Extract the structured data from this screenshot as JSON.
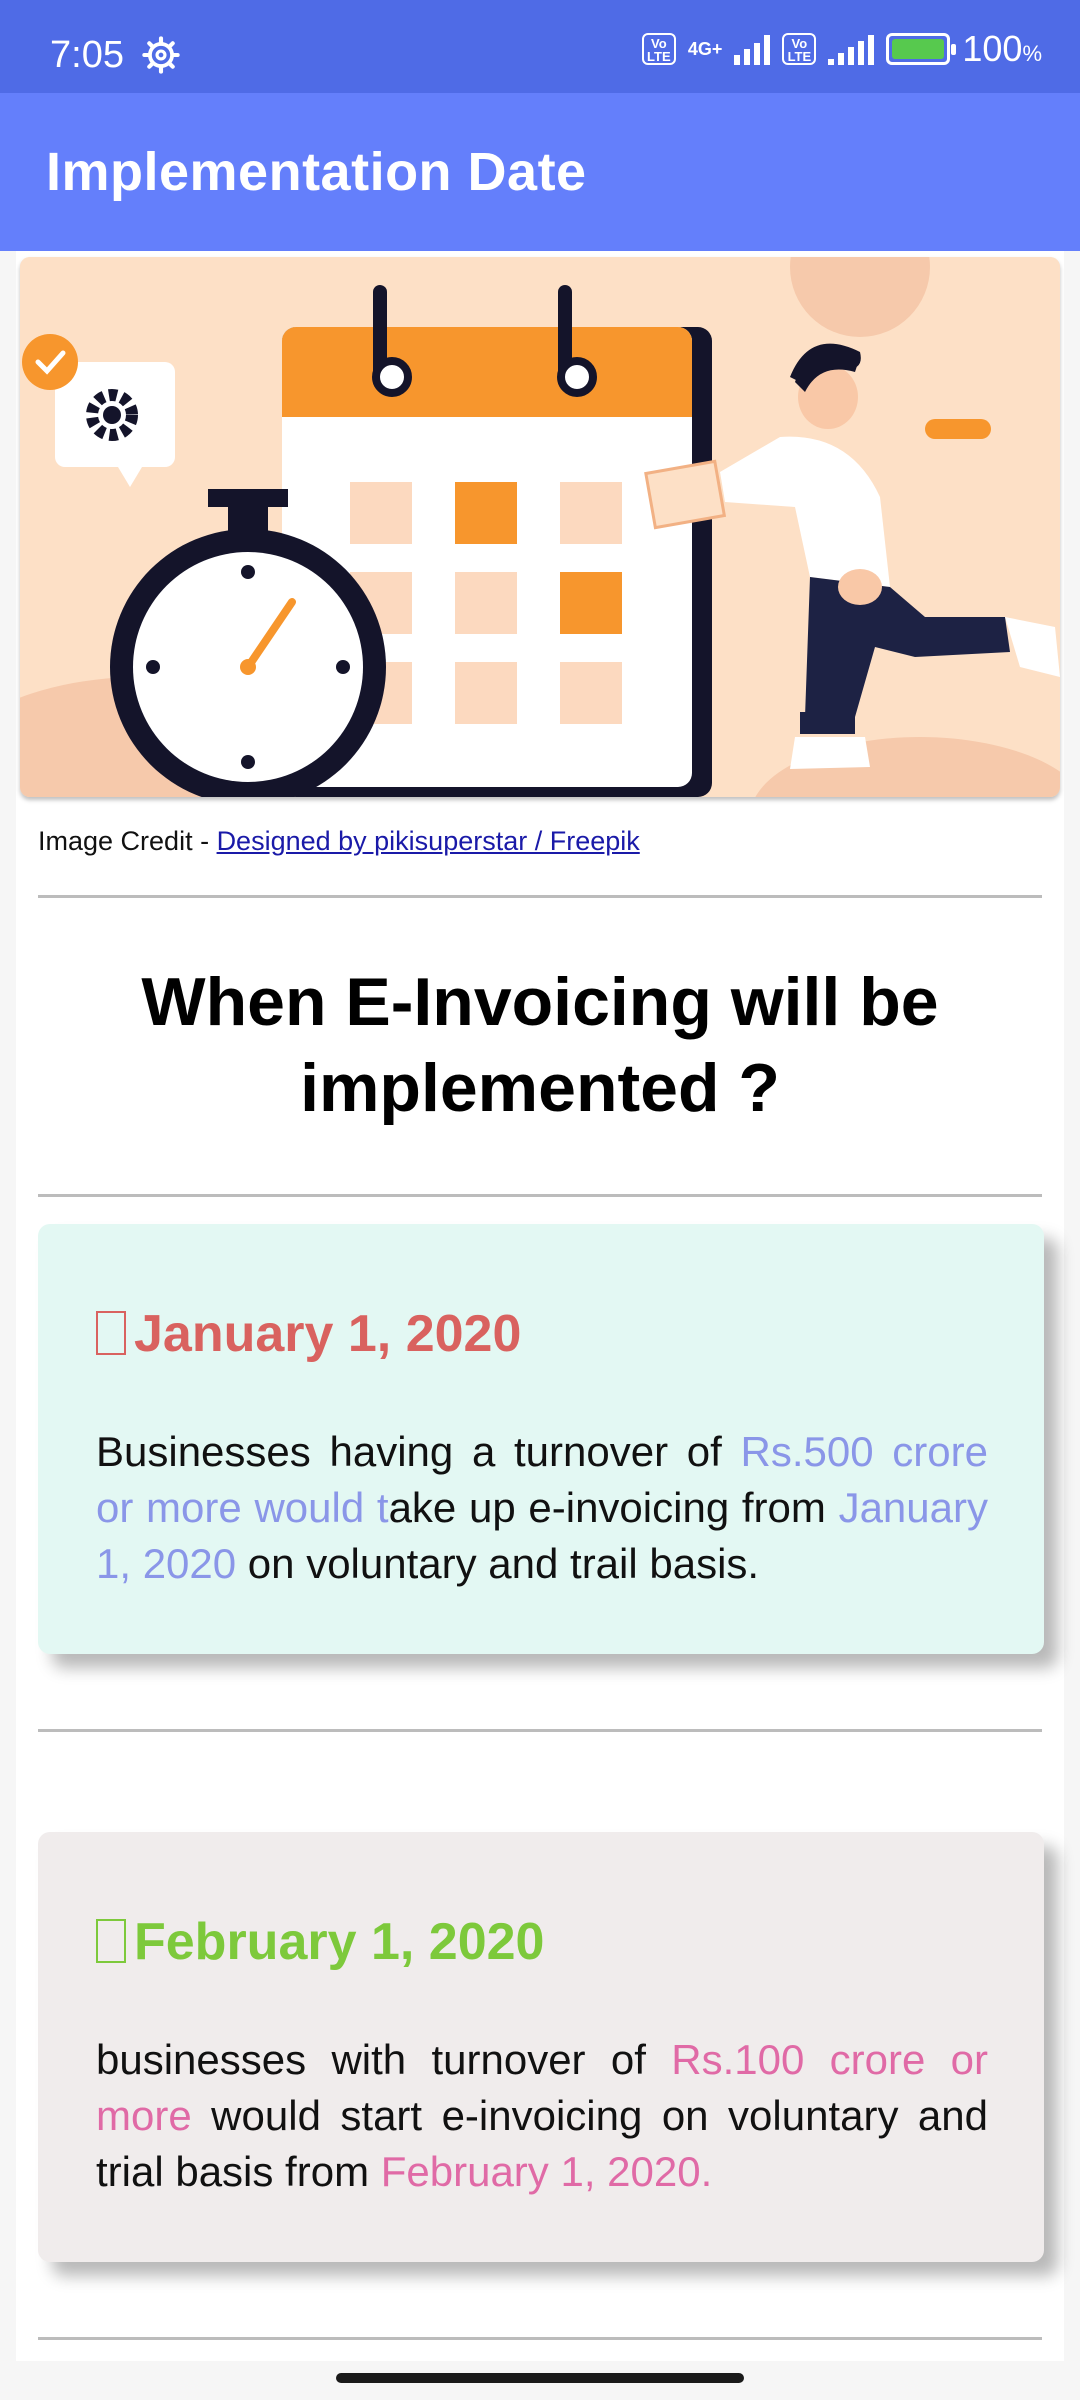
{
  "status_bar": {
    "time": "7:05",
    "lte1": "Vo LTE",
    "net": "4G+",
    "lte2": "Vo LTE",
    "battery": "100",
    "battery_unit": "%",
    "battery_level": 100
  },
  "app_bar": {
    "title": "Implementation Date"
  },
  "image_credit": {
    "prefix": "Image Credit - ",
    "link": "Designed by pikisuperstar / Freepik"
  },
  "heading": "When E-Invoicing will be implemented ?",
  "cards": [
    {
      "date": "January 1, 2020",
      "parts": [
        "Businesses having a turnover of ",
        "Rs.500 crore or more would t",
        "ake up e-invoicing from ",
        "January 1, 2020",
        " on voluntary and trail basis."
      ]
    },
    {
      "date": "February 1, 2020",
      "parts": [
        "businesses with turnover of ",
        "Rs.100 crore or more",
        " would start e-invoicing on voluntary and trial basis from ",
        "February 1, 2020."
      ]
    }
  ],
  "colors": {
    "status_bar": "#4f6be6",
    "app_bar": "#647ffb",
    "card1_bg": "#e3f8f3",
    "card1_date": "#d9625f",
    "card1_highlight": "#8a96e8",
    "card2_bg": "#f0ecec",
    "card2_date": "#7dc93b",
    "card2_highlight": "#e06aa6"
  }
}
